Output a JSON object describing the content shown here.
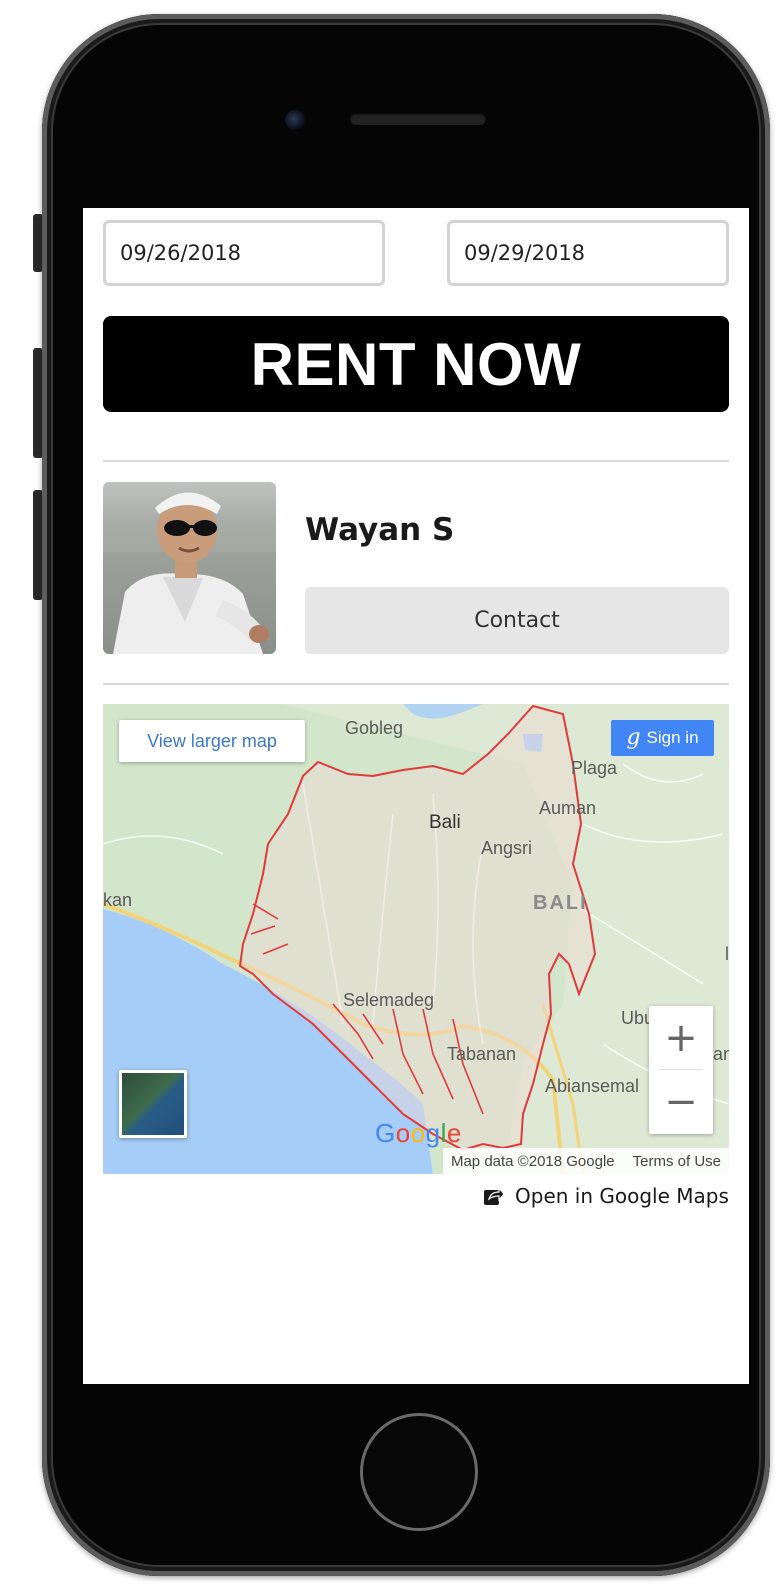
{
  "booking": {
    "start_date": "09/26/2018",
    "end_date": "09/29/2018",
    "rent_label": "RENT NOW"
  },
  "host": {
    "name": "Wayan S",
    "contact_label": "Contact",
    "avatar_icon": "host-photo"
  },
  "map": {
    "view_larger_label": "View larger map",
    "sign_in_g": "g",
    "sign_in_label": "Sign in",
    "places": {
      "gobleg": "Gobleg",
      "plaga": "Plaga",
      "bali_town": "Bali",
      "auman": "Auman",
      "angsri": "Angsri",
      "bali_region": "BALI",
      "kan": "kan",
      "selemadeg": "Selemadeg",
      "ubud": "Ubu",
      "tabanan": "Tabanan",
      "abiansemal": "Abiansemal",
      "edge_right": "an",
      "edge_l": "l"
    },
    "zoom_in": "+",
    "zoom_out": "−",
    "google_logo": "Google",
    "attribution": "Map data ©2018 Google",
    "terms": "Terms of Use",
    "open_label": "Open in Google Maps",
    "colors": {
      "water": "#a6cdf7",
      "land": "#d6e8cf",
      "boundary": "#e03a3a",
      "road": "#f2d37a"
    }
  }
}
